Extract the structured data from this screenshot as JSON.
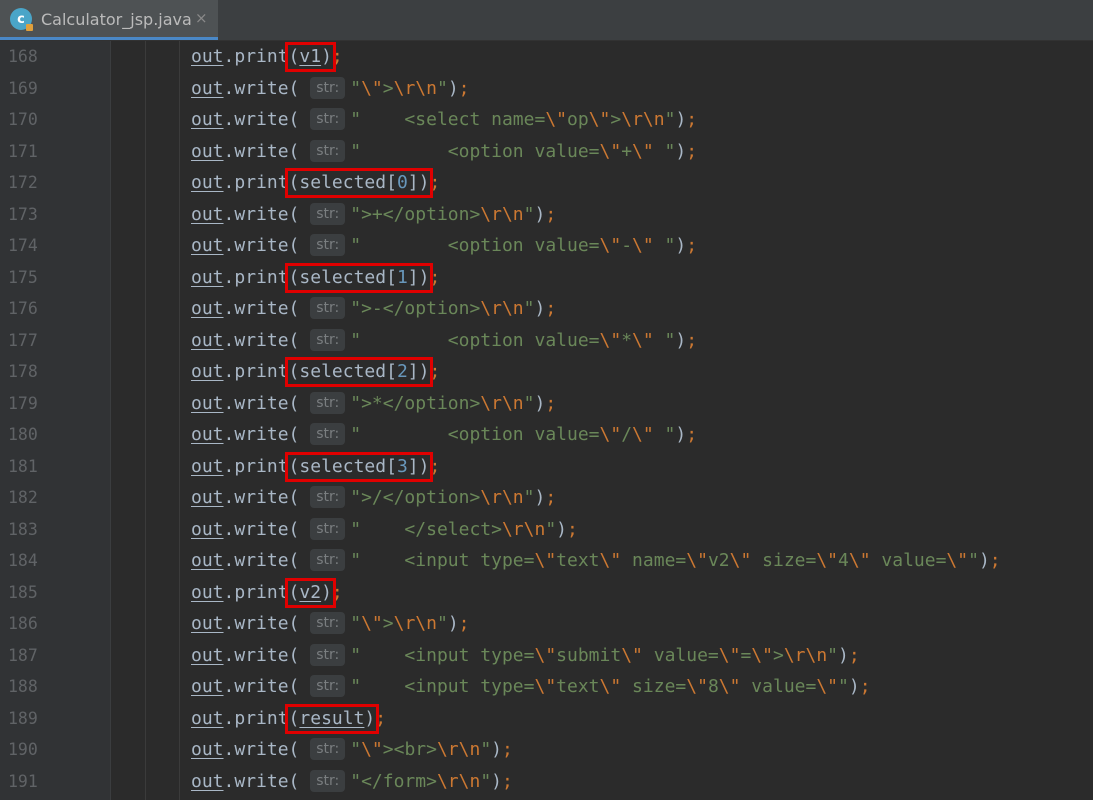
{
  "tab": {
    "title": "Calculator_jsp.java",
    "icon": "java-class-icon",
    "icon_letter": "c",
    "close": "×"
  },
  "hint_label": "str:",
  "lines": [
    {
      "n": "168",
      "kind": "print",
      "arg": "v1",
      "arg_parts": [
        {
          "t": "v1",
          "c": "var"
        }
      ],
      "highlight": true
    },
    {
      "n": "169",
      "kind": "write",
      "s": [
        {
          "t": "\"",
          "c": "str"
        },
        {
          "t": "\\\"",
          "c": "esc"
        },
        {
          "t": ">",
          "c": "str"
        },
        {
          "t": "\\r\\n",
          "c": "esc"
        },
        {
          "t": "\"",
          "c": "str"
        }
      ]
    },
    {
      "n": "170",
      "kind": "write",
      "s": [
        {
          "t": "\"    <select name=",
          "c": "str"
        },
        {
          "t": "\\\"",
          "c": "esc"
        },
        {
          "t": "op",
          "c": "str"
        },
        {
          "t": "\\\"",
          "c": "esc"
        },
        {
          "t": ">",
          "c": "str"
        },
        {
          "t": "\\r\\n",
          "c": "esc"
        },
        {
          "t": "\"",
          "c": "str"
        }
      ]
    },
    {
      "n": "171",
      "kind": "write",
      "s": [
        {
          "t": "\"        <option value=",
          "c": "str"
        },
        {
          "t": "\\\"",
          "c": "esc"
        },
        {
          "t": "+",
          "c": "str"
        },
        {
          "t": "\\\"",
          "c": "esc"
        },
        {
          "t": " \"",
          "c": "str"
        }
      ]
    },
    {
      "n": "172",
      "kind": "print",
      "arg_parts": [
        {
          "t": "selected[",
          "c": "p"
        },
        {
          "t": "0",
          "c": "num"
        },
        {
          "t": "]",
          "c": "p"
        }
      ],
      "highlight": true
    },
    {
      "n": "173",
      "kind": "write",
      "s": [
        {
          "t": "\">+</option>",
          "c": "str"
        },
        {
          "t": "\\r\\n",
          "c": "esc"
        },
        {
          "t": "\"",
          "c": "str"
        }
      ]
    },
    {
      "n": "174",
      "kind": "write",
      "s": [
        {
          "t": "\"        <option value=",
          "c": "str"
        },
        {
          "t": "\\\"",
          "c": "esc"
        },
        {
          "t": "-",
          "c": "str"
        },
        {
          "t": "\\\"",
          "c": "esc"
        },
        {
          "t": " \"",
          "c": "str"
        }
      ]
    },
    {
      "n": "175",
      "kind": "print",
      "arg_parts": [
        {
          "t": "selected[",
          "c": "p"
        },
        {
          "t": "1",
          "c": "num"
        },
        {
          "t": "]",
          "c": "p"
        }
      ],
      "highlight": true
    },
    {
      "n": "176",
      "kind": "write",
      "s": [
        {
          "t": "\">-</option>",
          "c": "str"
        },
        {
          "t": "\\r\\n",
          "c": "esc"
        },
        {
          "t": "\"",
          "c": "str"
        }
      ]
    },
    {
      "n": "177",
      "kind": "write",
      "s": [
        {
          "t": "\"        <option value=",
          "c": "str"
        },
        {
          "t": "\\\"",
          "c": "esc"
        },
        {
          "t": "*",
          "c": "str"
        },
        {
          "t": "\\\"",
          "c": "esc"
        },
        {
          "t": " \"",
          "c": "str"
        }
      ]
    },
    {
      "n": "178",
      "kind": "print",
      "arg_parts": [
        {
          "t": "selected[",
          "c": "p"
        },
        {
          "t": "2",
          "c": "num"
        },
        {
          "t": "]",
          "c": "p"
        }
      ],
      "highlight": true
    },
    {
      "n": "179",
      "kind": "write",
      "s": [
        {
          "t": "\">*</option>",
          "c": "str"
        },
        {
          "t": "\\r\\n",
          "c": "esc"
        },
        {
          "t": "\"",
          "c": "str"
        }
      ]
    },
    {
      "n": "180",
      "kind": "write",
      "s": [
        {
          "t": "\"        <option value=",
          "c": "str"
        },
        {
          "t": "\\\"",
          "c": "esc"
        },
        {
          "t": "/",
          "c": "str"
        },
        {
          "t": "\\\"",
          "c": "esc"
        },
        {
          "t": " \"",
          "c": "str"
        }
      ]
    },
    {
      "n": "181",
      "kind": "print",
      "arg_parts": [
        {
          "t": "selected[",
          "c": "p"
        },
        {
          "t": "3",
          "c": "num"
        },
        {
          "t": "]",
          "c": "p"
        }
      ],
      "highlight": true
    },
    {
      "n": "182",
      "kind": "write",
      "s": [
        {
          "t": "\">/</option>",
          "c": "str"
        },
        {
          "t": "\\r\\n",
          "c": "esc"
        },
        {
          "t": "\"",
          "c": "str"
        }
      ]
    },
    {
      "n": "183",
      "kind": "write",
      "s": [
        {
          "t": "\"    </select>",
          "c": "str"
        },
        {
          "t": "\\r\\n",
          "c": "esc"
        },
        {
          "t": "\"",
          "c": "str"
        }
      ]
    },
    {
      "n": "184",
      "kind": "write",
      "s": [
        {
          "t": "\"    <input type=",
          "c": "str"
        },
        {
          "t": "\\\"",
          "c": "esc"
        },
        {
          "t": "text",
          "c": "str"
        },
        {
          "t": "\\\"",
          "c": "esc"
        },
        {
          "t": " name=",
          "c": "str"
        },
        {
          "t": "\\\"",
          "c": "esc"
        },
        {
          "t": "v2",
          "c": "str"
        },
        {
          "t": "\\\"",
          "c": "esc"
        },
        {
          "t": " size=",
          "c": "str"
        },
        {
          "t": "\\\"",
          "c": "esc"
        },
        {
          "t": "4",
          "c": "str"
        },
        {
          "t": "\\\"",
          "c": "esc"
        },
        {
          "t": " value=",
          "c": "str"
        },
        {
          "t": "\\\"",
          "c": "esc"
        },
        {
          "t": "\"",
          "c": "str"
        }
      ]
    },
    {
      "n": "185",
      "kind": "print",
      "arg_parts": [
        {
          "t": "v2",
          "c": "var"
        }
      ],
      "highlight": true
    },
    {
      "n": "186",
      "kind": "write",
      "s": [
        {
          "t": "\"",
          "c": "str"
        },
        {
          "t": "\\\"",
          "c": "esc"
        },
        {
          "t": ">",
          "c": "str"
        },
        {
          "t": "\\r\\n",
          "c": "esc"
        },
        {
          "t": "\"",
          "c": "str"
        }
      ]
    },
    {
      "n": "187",
      "kind": "write",
      "s": [
        {
          "t": "\"    <input type=",
          "c": "str"
        },
        {
          "t": "\\\"",
          "c": "esc"
        },
        {
          "t": "submit",
          "c": "str"
        },
        {
          "t": "\\\"",
          "c": "esc"
        },
        {
          "t": " value=",
          "c": "str"
        },
        {
          "t": "\\\"",
          "c": "esc"
        },
        {
          "t": "=",
          "c": "str"
        },
        {
          "t": "\\\"",
          "c": "esc"
        },
        {
          "t": ">",
          "c": "str"
        },
        {
          "t": "\\r\\n",
          "c": "esc"
        },
        {
          "t": "\"",
          "c": "str"
        }
      ]
    },
    {
      "n": "188",
      "kind": "write",
      "s": [
        {
          "t": "\"    <input type=",
          "c": "str"
        },
        {
          "t": "\\\"",
          "c": "esc"
        },
        {
          "t": "text",
          "c": "str"
        },
        {
          "t": "\\\"",
          "c": "esc"
        },
        {
          "t": " size=",
          "c": "str"
        },
        {
          "t": "\\\"",
          "c": "esc"
        },
        {
          "t": "8",
          "c": "str"
        },
        {
          "t": "\\\"",
          "c": "esc"
        },
        {
          "t": " value=",
          "c": "str"
        },
        {
          "t": "\\\"",
          "c": "esc"
        },
        {
          "t": "\"",
          "c": "str"
        }
      ]
    },
    {
      "n": "189",
      "kind": "print",
      "arg_parts": [
        {
          "t": "result",
          "c": "var"
        }
      ],
      "highlight": true
    },
    {
      "n": "190",
      "kind": "write",
      "s": [
        {
          "t": "\"",
          "c": "str"
        },
        {
          "t": "\\\"",
          "c": "esc"
        },
        {
          "t": "><br>",
          "c": "str"
        },
        {
          "t": "\\r\\n",
          "c": "esc"
        },
        {
          "t": "\"",
          "c": "str"
        }
      ]
    },
    {
      "n": "191",
      "kind": "write",
      "s": [
        {
          "t": "\"</form>",
          "c": "str"
        },
        {
          "t": "\\r\\n",
          "c": "esc"
        },
        {
          "t": "\"",
          "c": "str"
        }
      ]
    }
  ],
  "colors": {
    "background": "#2b2b2b",
    "string": "#6a8759",
    "keyword": "#cc7832",
    "number": "#6897bb",
    "highlight_box": "#e00000"
  }
}
